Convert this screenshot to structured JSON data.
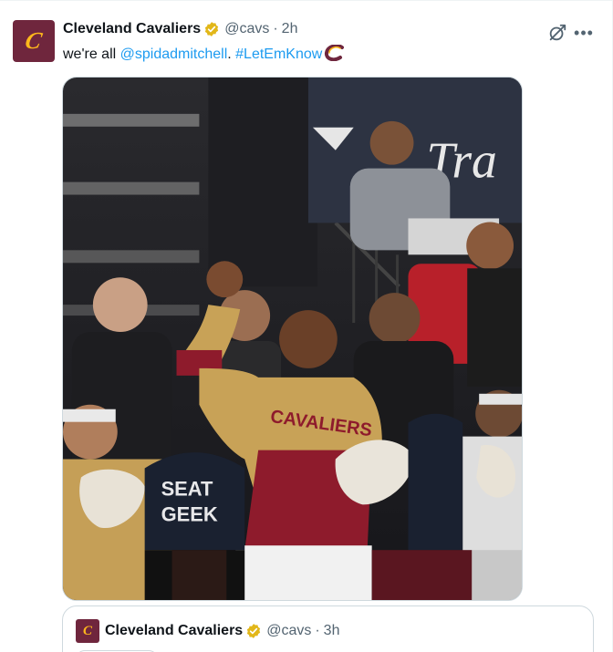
{
  "tweet": {
    "display_name": "Cleveland Cavaliers",
    "handle": "@cavs",
    "separator": "·",
    "time": "2h",
    "text_prefix": "we're all ",
    "mention": "@spidadmitchell",
    "text_mid": ". ",
    "hashtag": "#LetEmKnow",
    "emoji": "cavs-c-emoji",
    "icons": [
      "verified-badge-icon",
      "grok-icon",
      "more-icon"
    ]
  },
  "media": {
    "type": "video-gif",
    "banner_text": "Tra",
    "sign_text_line1": "SEAT",
    "sign_text_line2": "GEEK",
    "jersey_text": "CAVALIERS"
  },
  "quote": {
    "display_name": "Cleveland Cavaliers",
    "handle": "@cavs",
    "separator": "·",
    "time": "3h"
  },
  "colors": {
    "brand_wine": "#6f263d",
    "brand_gold": "#ffb81c",
    "link_blue": "#1d9bf0",
    "muted": "#536471",
    "verified_gold": "#e2b719"
  }
}
